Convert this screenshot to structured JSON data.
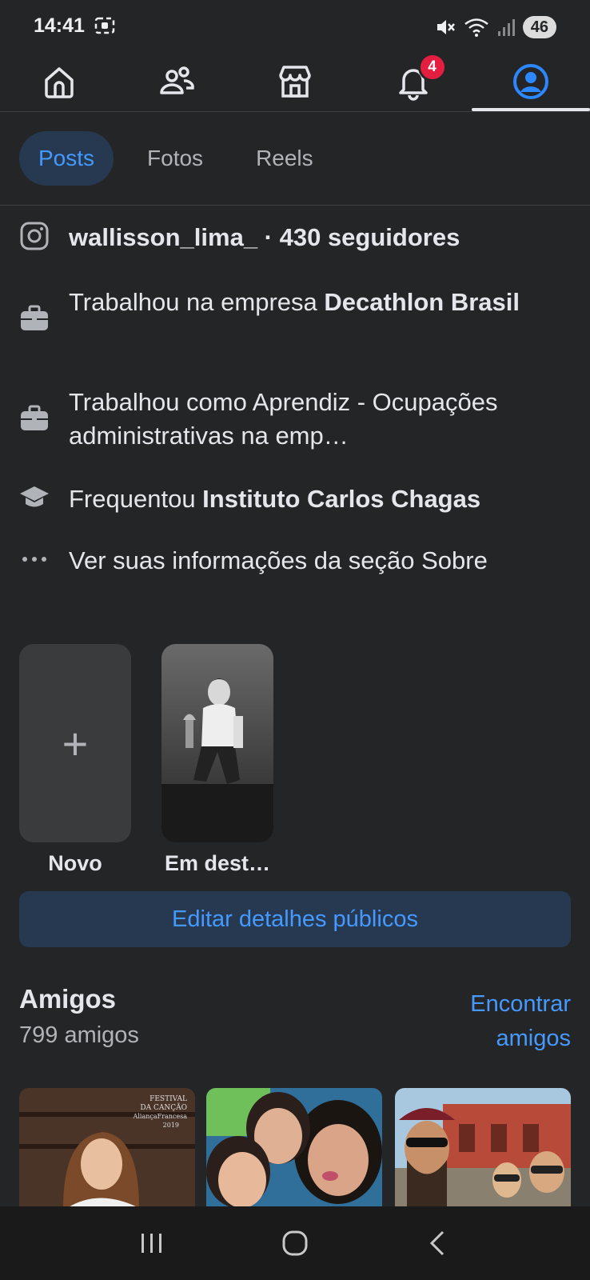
{
  "status": {
    "time": "14:41",
    "battery": "46"
  },
  "nav": {
    "notification_count": "4"
  },
  "tabs": [
    {
      "label": "Posts"
    },
    {
      "label": "Fotos"
    },
    {
      "label": "Reels"
    }
  ],
  "intro": {
    "instagram": "wallisson_lima_ · 430 seguidores",
    "work1_prefix": "Trabalhou na empresa ",
    "work1_company": "Decathlon Brasil",
    "work2": "Trabalhou como Aprendiz - Ocupações administrativas na emp…",
    "edu_prefix": "Frequentou ",
    "edu_school": "Instituto Carlos Chagas",
    "about_link": "Ver suas informações da seção Sobre"
  },
  "highlights": {
    "new_label": "Novo",
    "featured_label": "Em dest…"
  },
  "edit_button": "Editar detalhes públicos",
  "friends": {
    "title": "Amigos",
    "count": "799 amigos",
    "find_link": "Encontrar amigos",
    "photo1_text": "FESTIVAL DA CANÇÃO AliançaFrancesa 2019"
  },
  "colors": {
    "accent": "#4599ff",
    "badge": "#e41e3f",
    "background": "#242526"
  }
}
